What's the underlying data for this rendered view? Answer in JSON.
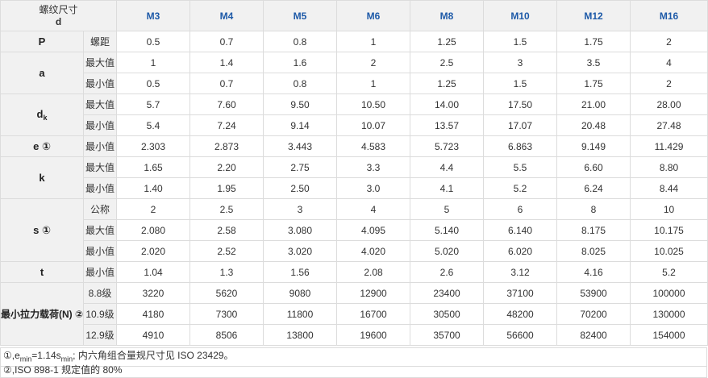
{
  "header": {
    "corner_line1": "螺纹尺寸",
    "corner_line2": "d",
    "sizes": [
      "M3",
      "M4",
      "M5",
      "M6",
      "M8",
      "M10",
      "M12",
      "M16"
    ]
  },
  "rows": [
    {
      "param": "P",
      "sub": "螺距",
      "values": [
        "0.5",
        "0.7",
        "0.8",
        "1",
        "1.25",
        "1.5",
        "1.75",
        "2"
      ]
    },
    {
      "param": "a",
      "sub": "最大值",
      "values": [
        "1",
        "1.4",
        "1.6",
        "2",
        "2.5",
        "3",
        "3.5",
        "4"
      ]
    },
    {
      "sub": "最小值",
      "values": [
        "0.5",
        "0.7",
        "0.8",
        "1",
        "1.25",
        "1.5",
        "1.75",
        "2"
      ]
    },
    {
      "param": "d",
      "param_sub": "k",
      "sub": "最大值",
      "values": [
        "5.7",
        "7.60",
        "9.50",
        "10.50",
        "14.00",
        "17.50",
        "21.00",
        "28.00"
      ]
    },
    {
      "sub": "最小值",
      "values": [
        "5.4",
        "7.24",
        "9.14",
        "10.07",
        "13.57",
        "17.07",
        "20.48",
        "27.48"
      ]
    },
    {
      "param": "e ①",
      "sub": "最小值",
      "values": [
        "2.303",
        "2.873",
        "3.443",
        "4.583",
        "5.723",
        "6.863",
        "9.149",
        "11.429"
      ]
    },
    {
      "param": "k",
      "sub": "最大值",
      "values": [
        "1.65",
        "2.20",
        "2.75",
        "3.3",
        "4.4",
        "5.5",
        "6.60",
        "8.80"
      ]
    },
    {
      "sub": "最小值",
      "values": [
        "1.40",
        "1.95",
        "2.50",
        "3.0",
        "4.1",
        "5.2",
        "6.24",
        "8.44"
      ]
    },
    {
      "param": "s ①",
      "sub": "公称",
      "values": [
        "2",
        "2.5",
        "3",
        "4",
        "5",
        "6",
        "8",
        "10"
      ]
    },
    {
      "sub": "最大值",
      "values": [
        "2.080",
        "2.58",
        "3.080",
        "4.095",
        "5.140",
        "6.140",
        "8.175",
        "10.175"
      ]
    },
    {
      "sub": "最小值",
      "values": [
        "2.020",
        "2.52",
        "3.020",
        "4.020",
        "5.020",
        "6.020",
        "8.025",
        "10.025"
      ]
    },
    {
      "param": "t",
      "sub": "最小值",
      "values": [
        "1.04",
        "1.3",
        "1.56",
        "2.08",
        "2.6",
        "3.12",
        "4.16",
        "5.2"
      ]
    },
    {
      "param": "最小拉力载荷(N) ②",
      "sub": "8.8级",
      "values": [
        "3220",
        "5620",
        "9080",
        "12900",
        "23400",
        "37100",
        "53900",
        "100000"
      ]
    },
    {
      "sub": "10.9级",
      "values": [
        "4180",
        "7300",
        "11800",
        "16700",
        "30500",
        "48200",
        "70200",
        "130000"
      ]
    },
    {
      "sub": "12.9级",
      "values": [
        "4910",
        "8506",
        "13800",
        "19600",
        "35700",
        "56600",
        "82400",
        "154000"
      ]
    }
  ],
  "notes": {
    "note1_prefix": "①,e",
    "note1_sub1": "min",
    "note1_mid": "=1.14s",
    "note1_sub2": "min",
    "note1_suffix": "; 内六角组合量规尺寸见 ISO 23429。",
    "note2": "②,ISO 898-1 规定值的 80%"
  }
}
